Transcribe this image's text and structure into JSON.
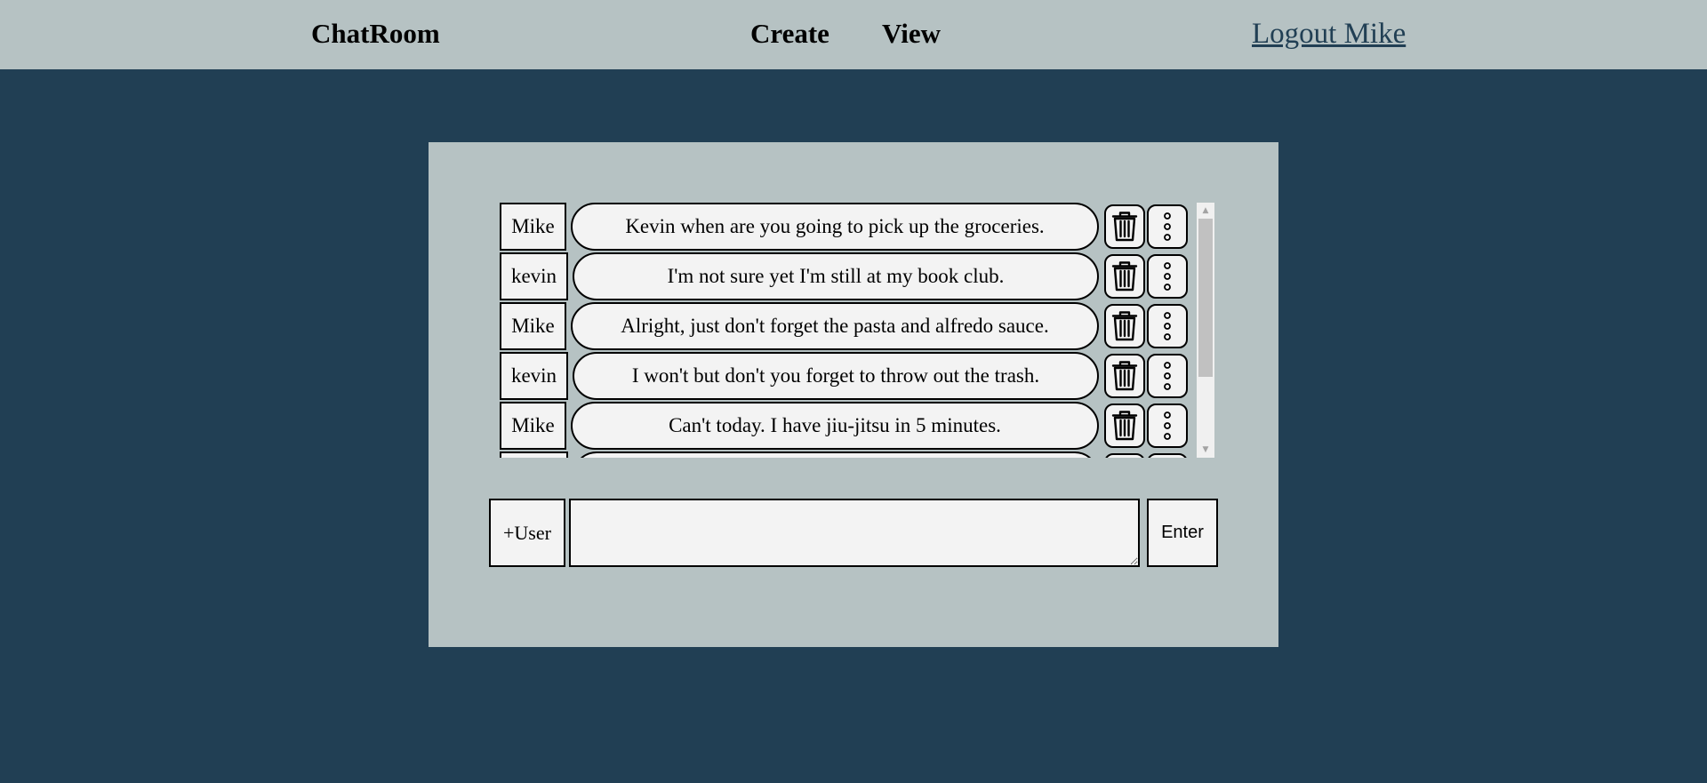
{
  "header": {
    "brand": "ChatRoom",
    "nav": [
      {
        "label": "Create"
      },
      {
        "label": "View"
      }
    ],
    "logout_label": "Logout Mike"
  },
  "chat": {
    "messages": [
      {
        "user": "Mike",
        "text": "Kevin when are you going to pick up the groceries."
      },
      {
        "user": "kevin",
        "text": "I'm not sure yet I'm still at my book club."
      },
      {
        "user": "Mike",
        "text": "Alright, just don't forget the pasta and alfredo sauce."
      },
      {
        "user": "kevin",
        "text": "I won't but don't you forget to throw out the trash."
      },
      {
        "user": "Mike",
        "text": "Can't today. I have jiu-jitsu in 5 minutes."
      }
    ],
    "delete_icon": "trash-icon",
    "menu_icon": "more-vertical-icon"
  },
  "composer": {
    "add_user_label": "+User",
    "message_value": "",
    "enter_label": "Enter"
  },
  "colors": {
    "page_bg": "#213f54",
    "panel_bg": "#b6c2c3",
    "bubble_bg": "#f3f3f3",
    "link": "#213f54"
  }
}
